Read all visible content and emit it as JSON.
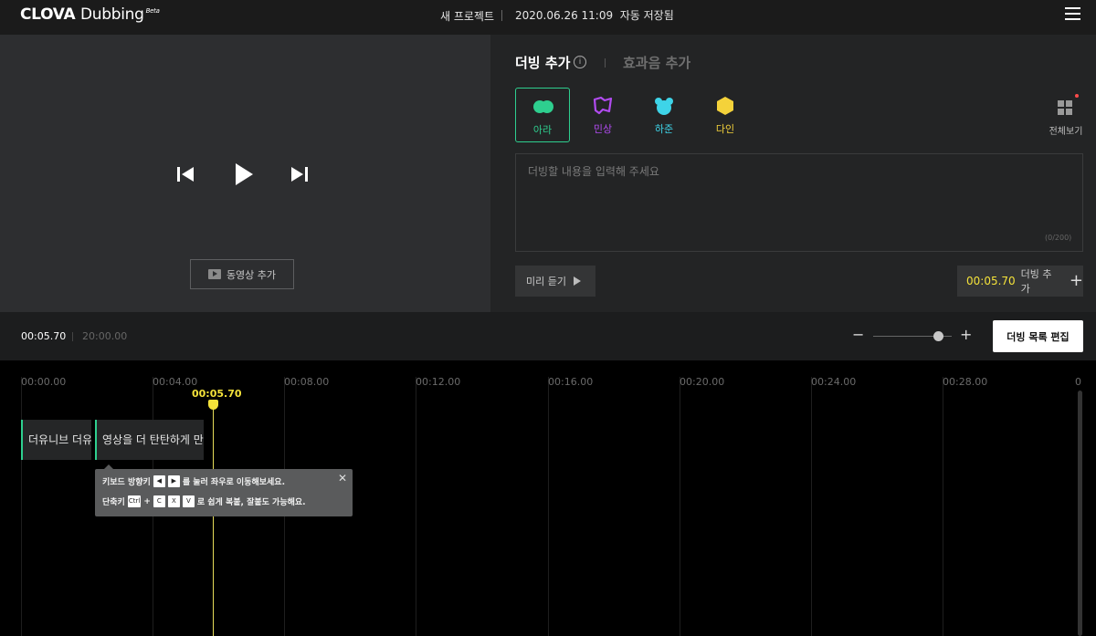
{
  "header": {
    "logo_brand": "CLOVA",
    "logo_product": "Dubbing",
    "logo_beta": "Beta",
    "project_title": "새 프로젝트",
    "save_status": "2020.06.26 11:09  자동 저장됨",
    "menu_icon": "hamburger-menu-icon"
  },
  "player": {
    "prev_icon": "skip-previous-icon",
    "play_icon": "play-icon",
    "next_icon": "skip-next-icon",
    "add_video_label": "동영상 추가"
  },
  "dub_panel": {
    "tab_dub": "더빙 추가",
    "tab_sfx": "효과음 추가",
    "voices": [
      {
        "name": "아라",
        "color": "#2ecf8f",
        "selected": true
      },
      {
        "name": "민상",
        "color": "#b14bf0",
        "selected": false
      },
      {
        "name": "하준",
        "color": "#3ed4e8",
        "selected": false
      },
      {
        "name": "다인",
        "color": "#f4d23a",
        "selected": false
      }
    ],
    "view_all_label": "전체보기",
    "text_placeholder": "더빙할 내용을 입력해 주세요",
    "char_count": "(0/200)",
    "preview_label": "미리 듣기",
    "add_dub_time": "00:05.70",
    "add_dub_label": "더빙 추가"
  },
  "time_bar": {
    "current_time": "00:05.70",
    "total_time": "20:00.00",
    "zoom_level": 0.8,
    "edit_list_label": "더빙 목록 편집"
  },
  "timeline": {
    "ticks": [
      "00:00.00",
      "00:04.00",
      "00:08.00",
      "00:12.00",
      "00:16.00",
      "00:20.00",
      "00:24.00",
      "00:28.00",
      "0"
    ],
    "playhead_time": "00:05.70",
    "clips": [
      {
        "text": "더유니브 더유니"
      },
      {
        "text": "영상을 더 탄탄하게 만들"
      }
    ],
    "tooltip": {
      "line1_a": "키보드 방향키",
      "key_left": "◀",
      "key_right": "▶",
      "line1_b": "를 눌러 좌우로 이동해보세요.",
      "line2_a": "단축키",
      "key_ctrl": "Ctrl",
      "plus": "+",
      "key_c": "C",
      "key_x": "X",
      "key_v": "V",
      "line2_b": "로 쉽게 복붙, 잘붙도 가능해요."
    }
  },
  "colors": {
    "accent": "#2ecf8f",
    "time_highlight": "#f4e23a"
  }
}
